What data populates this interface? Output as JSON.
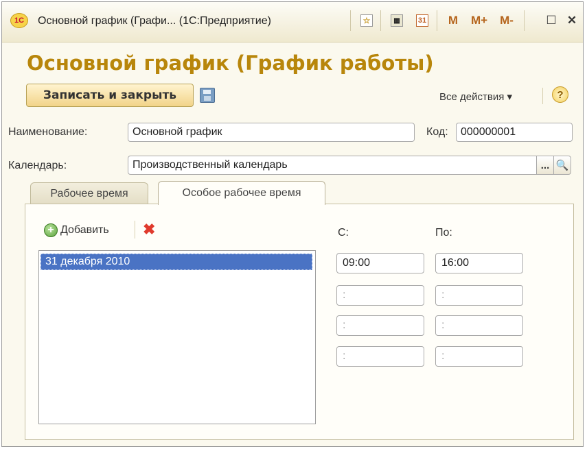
{
  "window": {
    "logo_text": "1С",
    "title": "Основной график (Графи... (1С:Предприятие)",
    "toolbar": {
      "m_label": "M",
      "mplus_label": "M+",
      "mminus_label": "M-",
      "close_label": "✕",
      "maximize_label": "☐",
      "calendar_day": "31"
    }
  },
  "form": {
    "title": "Основной график (График работы)",
    "save_close_label": "Записать и закрыть",
    "all_actions_label": "Все действия ▾",
    "help_label": "?"
  },
  "fields": {
    "name_label": "Наименование:",
    "name_value": "Основной график",
    "code_label": "Код:",
    "code_value": "000000001",
    "calendar_label": "Календарь:",
    "calendar_value": "Производственный календарь",
    "select_label": "...",
    "search_label": "🔍"
  },
  "tabs": [
    {
      "label": "Рабочее время",
      "active": false
    },
    {
      "label": "Особое рабочее время",
      "active": true
    }
  ],
  "special_time": {
    "add_label": "Добавить",
    "delete_label": "✖",
    "from_label": "С:",
    "to_label": "По:",
    "dates": [
      "31 декабря 2010"
    ],
    "intervals": [
      {
        "from": "09:00",
        "to": "16:00"
      },
      {
        "from": " :",
        "to": " :"
      },
      {
        "from": " :",
        "to": " :"
      },
      {
        "from": " :",
        "to": " :"
      }
    ]
  },
  "colors": {
    "title": "#b8860b",
    "selection": "#4a73c4",
    "delete": "#e03a2d",
    "add": "#5ba33b"
  }
}
